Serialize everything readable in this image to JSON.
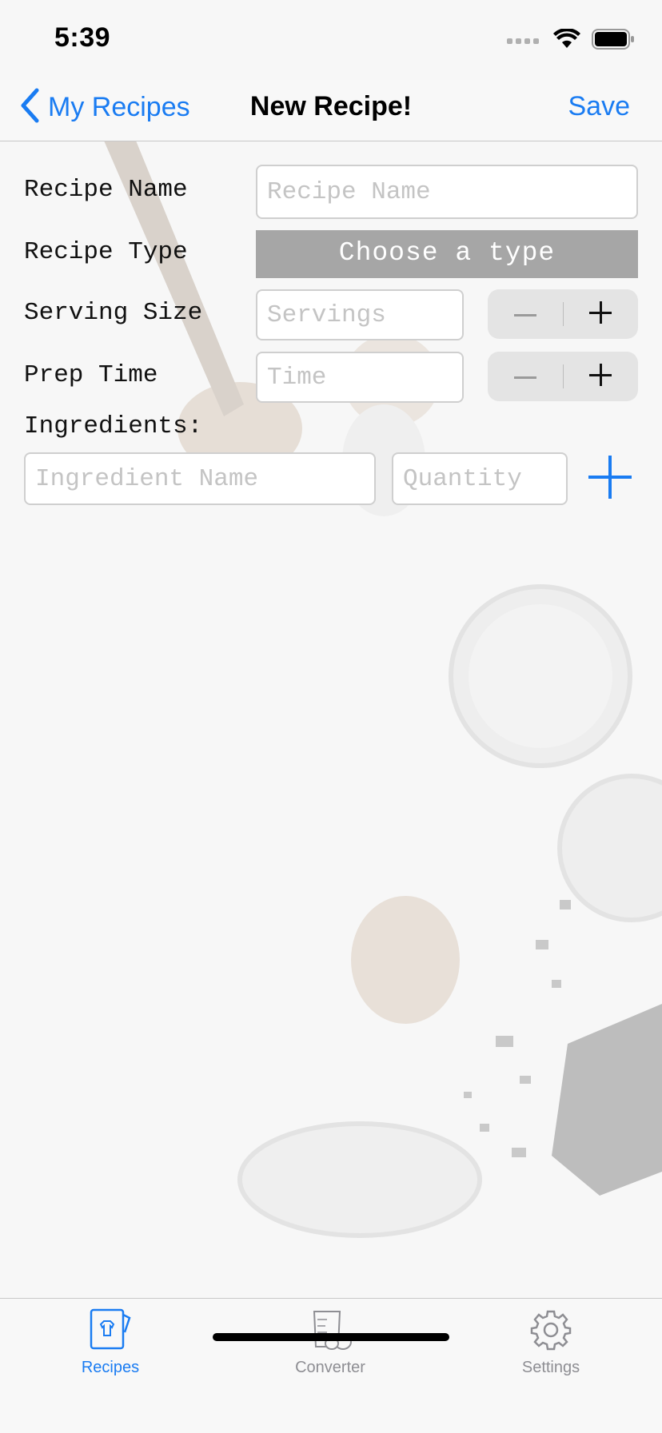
{
  "status_bar": {
    "time": "5:39"
  },
  "nav": {
    "back_label": "My Recipes",
    "title": "New Recipe!",
    "save_label": "Save"
  },
  "form": {
    "recipe_name": {
      "label": "Recipe Name",
      "placeholder": "Recipe Name",
      "value": ""
    },
    "recipe_type": {
      "label": "Recipe Type",
      "button_label": "Choose a type"
    },
    "serving_size": {
      "label": "Serving Size",
      "placeholder": "Servings",
      "value": ""
    },
    "prep_time": {
      "label": "Prep Time",
      "placeholder": "Time",
      "value": ""
    },
    "ingredients": {
      "label": "Ingredients:",
      "name_placeholder": "Ingredient Name",
      "quantity_placeholder": "Quantity"
    }
  },
  "tabs": [
    {
      "label": "Recipes",
      "icon": "recipe-book-icon",
      "selected": true
    },
    {
      "label": "Converter",
      "icon": "measuring-cup-icon",
      "selected": false
    },
    {
      "label": "Settings",
      "icon": "gear-icon",
      "selected": false
    }
  ],
  "colors": {
    "accent": "#1a7cf2",
    "type_button": "#a6a6a6",
    "inactive_tab": "#8e8e93"
  }
}
